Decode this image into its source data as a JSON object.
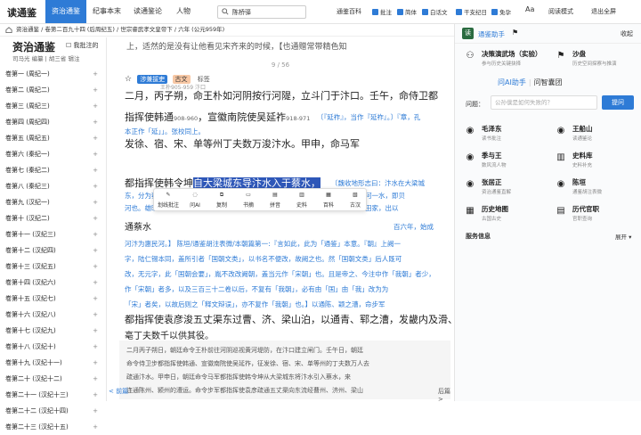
{
  "app": {
    "logo": "读通鉴"
  },
  "nav": {
    "tabs": [
      "资治通鉴",
      "纪事本末",
      "读通鉴论",
      "人物"
    ],
    "active": 0
  },
  "search": {
    "value": "陈桥驿"
  },
  "toolbar": {
    "lib": "通鉴百科",
    "checks": [
      "批注",
      "简体",
      "白话文",
      "干支纪日",
      "免孕"
    ],
    "font_size": "Aa",
    "read_mode": "阅读模式",
    "fullscreen": "退出全屏"
  },
  "breadcrumb": "资治通鉴 / 卷第二百九十四 (后周纪五) / 世宗睿武孝文皇帝下 / 六年 (公元959年)",
  "book": {
    "title": "资治通鉴",
    "my_annotations": "我批注的",
    "meta": "司马光 编纂 | 胡三省 辑注",
    "volumes": [
      "卷第一 (周纪一)",
      "卷第二 (周纪二)",
      "卷第三 (周纪三)",
      "卷第四 (周纪四)",
      "卷第五 (周纪五)",
      "卷第六 (秦纪一)",
      "卷第七 (秦纪二)",
      "卷第八 (秦纪三)",
      "卷第九 (汉纪一)",
      "卷第十 (汉纪二)",
      "卷第十一 (汉纪三)",
      "卷第十二 (汉纪四)",
      "卷第十三 (汉纪五)",
      "卷第十四 (汉纪六)",
      "卷第十五 (汉纪七)",
      "卷第十六 (汉纪八)",
      "卷第十七 (汉纪九)",
      "卷第十八 (汉纪十)",
      "卷第十九 (汉纪十一)",
      "卷第二十 (汉纪十二)",
      "卷第二十一 (汉纪十三)",
      "卷第二十二 (汉纪十四)",
      "卷第二十三 (汉纪十五)"
    ]
  },
  "reader": {
    "prev_line": "上，适然的是没有让他看见宋齐来的时候，【也通赠常带精色知",
    "page": "9 / 56",
    "tags": [
      "涉兼拔吏",
      "古文",
      "标签"
    ],
    "line1": "二月，丙子朔，命王朴如河阴按行河隄，立斗门于汴口。壬午，命侍卫都",
    "ann1": "王朴905-959                                          汴口",
    "line2a": "指挥使韩通",
    "line2b": "，宣徽南院使吴延祚",
    "line2c": "发徐、宿、宋、单等州丁夫数万浚汴水。甲申，命马军",
    "small2": "908-960",
    "small2b": "918-971",
    "ann2": "〔『延祚』，当作『延祚』。〕『章，孔",
    "line3a": "本正作「延」」。张校同上。",
    "line3b": "都指挥使韩令坤",
    "line3c": "自大梁城东导汴水入于蔡水，",
    "line3d": "〔魏收地形志曰：汴水在大梁城",
    "quote1": "东，分为蔡渠。九域志曰：渡仪县之据东沟，即蔡河也。国子蔡渠说：惠民河与蔡河一水，即贝",
    "quote2": "河也。雄晓元年，秘金而多筑城用河下者是以到来北自朝雄与道者会，世书有：宿田家，出以",
    "line4a": "通蔡水",
    "line4b": "百六年，始成",
    "quote3": "河汴为惠民河。】 陈垣/通鉴胡注表微/本朝篇第一:『言如此，此为「通鉴」本意。『朝』上阙一",
    "quote4": "字，陆仁锡本同，盖所引者「国朝文类」，以书名不便改，故阙之也。然「国朝文类」后人既可",
    "quote5": "改，无元字，此「国朝会要」，胤不改改阙朝，盖当元作「宋朝」也。且是帝之、今注中作「我朝」者少，",
    "quote6": "作「宋朝」者多，以及三百三十二卷以后，不复有「我朝」，必有由「国」由「我」改为为",
    "quote7": "「宋」者矣，以故后则之「释文辩误」，亦不复作「我朝」也。】以通陈、颖之漕，命步军",
    "line5": "都指挥使袁彦浚五丈渠东过曹、济、梁山泊，以通青、郓之漕，发畿内及滑、",
    "line6": "亳丁夫数千以供其役。",
    "summary": [
      "二月丙子朔日，朝廷命令王朴前往河阴巡视黄河堤防，在汴口建立闸门。壬午日，朝廷",
      "命令侍卫步都指挥使韩通、宣徽南院使吴延祚，征发徐、宿、宋、单等州的丁夫数万人去",
      "疏通汴水。甲申日，朝廷命令马军都指挥使韩令坤从大梁城东将汴水引入蔡水，来",
      "连通陈州、颍州的漕运。命令步军都指挥使袁彦疏通五丈渠向东流经曹州、济州、梁山"
    ],
    "prev": "< 前篇",
    "next": "后篇 >"
  },
  "popup": {
    "buttons": [
      "划线批注",
      "问AI",
      "复制",
      "书摘",
      "拼音",
      "史料",
      "百科",
      "古汉"
    ]
  },
  "assistant": {
    "title": "通鉴助手",
    "collapse": "收起",
    "cards": [
      {
        "title": "决策演武场（实验）",
        "sub": "参与历史关键抉择"
      },
      {
        "title": "沙盘",
        "sub": "历史空间探察与推演"
      },
      {
        "title": "毛泽东",
        "sub": "读书批注"
      },
      {
        "title": "王船山",
        "sub": "读通鉴论"
      },
      {
        "title": "季与王",
        "sub": "数风流人物"
      },
      {
        "title": "史料库",
        "sub": "史料补充"
      },
      {
        "title": "张居正",
        "sub": "资治通鉴直解"
      },
      {
        "title": "陈垣",
        "sub": "通鉴胡注表微"
      },
      {
        "title": "历史地图",
        "sub": "古国古史"
      },
      {
        "title": "历代官职",
        "sub": "官职查询"
      }
    ],
    "ai_tabs": [
      "问AI助手",
      "问智囊团"
    ],
    "question_label": "问题：",
    "question_placeholder": "公孙僕是如何失败的？",
    "ask": "提问",
    "services": "服务信息",
    "expand": "展开 ▾"
  }
}
